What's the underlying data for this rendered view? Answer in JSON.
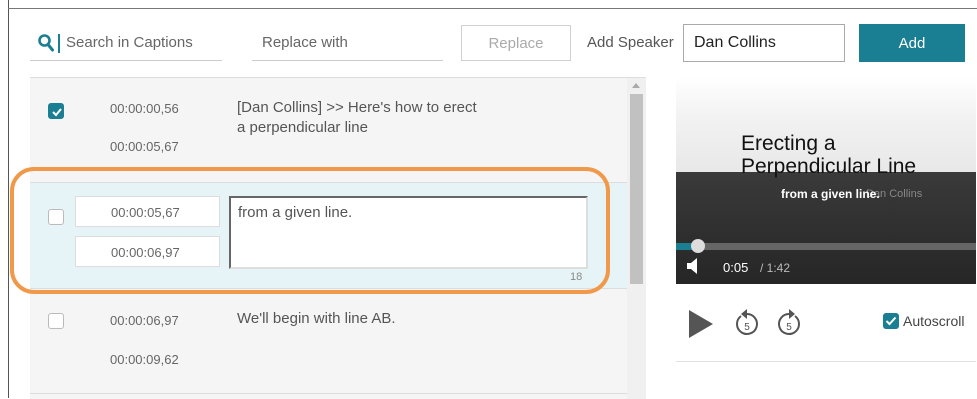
{
  "toolbar": {
    "search_placeholder": "Search in Captions",
    "replace_placeholder": "Replace with",
    "replace_button": "Replace",
    "add_speaker_label": "Add Speaker",
    "speaker_value": "Dan Collins",
    "add_button": "Add"
  },
  "captions": [
    {
      "checked": true,
      "start": "00:00:00,56",
      "end": "00:00:05,67",
      "text_line1": "[Dan Collins] >> Here's how to erect",
      "text_line2": "a perpendicular line"
    },
    {
      "checked": false,
      "start": "00:00:05,67",
      "end": "00:00:06,97",
      "text": "from a given line.",
      "char_count": "18"
    },
    {
      "checked": false,
      "start": "00:00:06,97",
      "end": "00:00:09,62",
      "text": "We'll begin with line AB."
    }
  ],
  "video": {
    "title_line1": "Erecting a",
    "title_line2": "Perpendicular Line",
    "overlay_caption": "from a given line.",
    "author": "Dan Collins",
    "current_time": "0:05",
    "duration": "/ 1:42",
    "progress_fraction": 0.05
  },
  "controls": {
    "autoscroll_label": "Autoscroll",
    "autoscroll_checked": true,
    "rewind_seconds": "5",
    "forward_seconds": "5"
  },
  "colors": {
    "accent": "#1a7f93",
    "highlight": "#f0994a"
  },
  "icons": [
    "search-icon",
    "check-icon",
    "play-icon",
    "rewind-5-icon",
    "forward-5-icon",
    "volume-icon"
  ]
}
